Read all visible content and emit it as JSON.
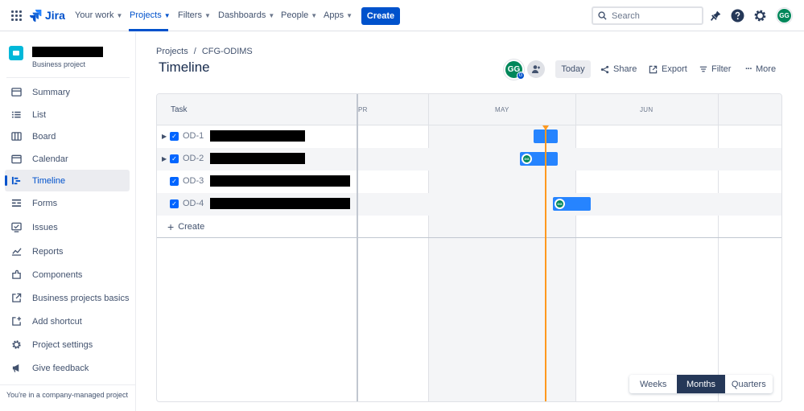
{
  "topnav": {
    "brand": "Jira",
    "items": [
      {
        "label": "Your work"
      },
      {
        "label": "Projects"
      },
      {
        "label": "Filters"
      },
      {
        "label": "Dashboards"
      },
      {
        "label": "People"
      },
      {
        "label": "Apps"
      }
    ],
    "create_label": "Create",
    "search_placeholder": "Search",
    "user_initials": "GG"
  },
  "sidebar": {
    "project_type": "Business project",
    "items": [
      {
        "label": "Summary",
        "icon": "summary-icon"
      },
      {
        "label": "List",
        "icon": "list-icon"
      },
      {
        "label": "Board",
        "icon": "board-icon"
      },
      {
        "label": "Calendar",
        "icon": "calendar-icon"
      },
      {
        "label": "Timeline",
        "icon": "timeline-icon"
      },
      {
        "label": "Forms",
        "icon": "forms-icon"
      },
      {
        "label": "Issues",
        "icon": "issues-icon"
      },
      {
        "label": "Reports",
        "icon": "reports-icon"
      },
      {
        "label": "Components",
        "icon": "components-icon"
      },
      {
        "label": "Business projects basics",
        "icon": "external-link-icon"
      },
      {
        "label": "Add shortcut",
        "icon": "add-shortcut-icon"
      },
      {
        "label": "Project settings",
        "icon": "gear-icon"
      },
      {
        "label": "Give feedback",
        "icon": "megaphone-icon"
      }
    ],
    "footer": "You're in a company-managed project"
  },
  "header": {
    "breadcrumb": [
      "Projects",
      "CFG-ODIMS"
    ],
    "breadcrumb_sep": "/",
    "title": "Timeline",
    "avatar_initials": "GG",
    "avatar_badge": "G",
    "today_label": "Today",
    "share_label": "Share",
    "export_label": "Export",
    "filter_label": "Filter",
    "more_label": "More"
  },
  "timeline": {
    "task_header": "Task",
    "months": [
      "PR",
      "MAY",
      "JUN"
    ],
    "rows": [
      {
        "key": "OD-1",
        "expandable": true
      },
      {
        "key": "OD-2",
        "expandable": true,
        "assignee": "GG"
      },
      {
        "key": "OD-3",
        "expandable": false
      },
      {
        "key": "OD-4",
        "expandable": false,
        "assignee": "GG"
      }
    ],
    "create_label": "Create",
    "zoom": {
      "options": [
        "Weeks",
        "Months",
        "Quarters"
      ],
      "selected": "Months"
    }
  }
}
